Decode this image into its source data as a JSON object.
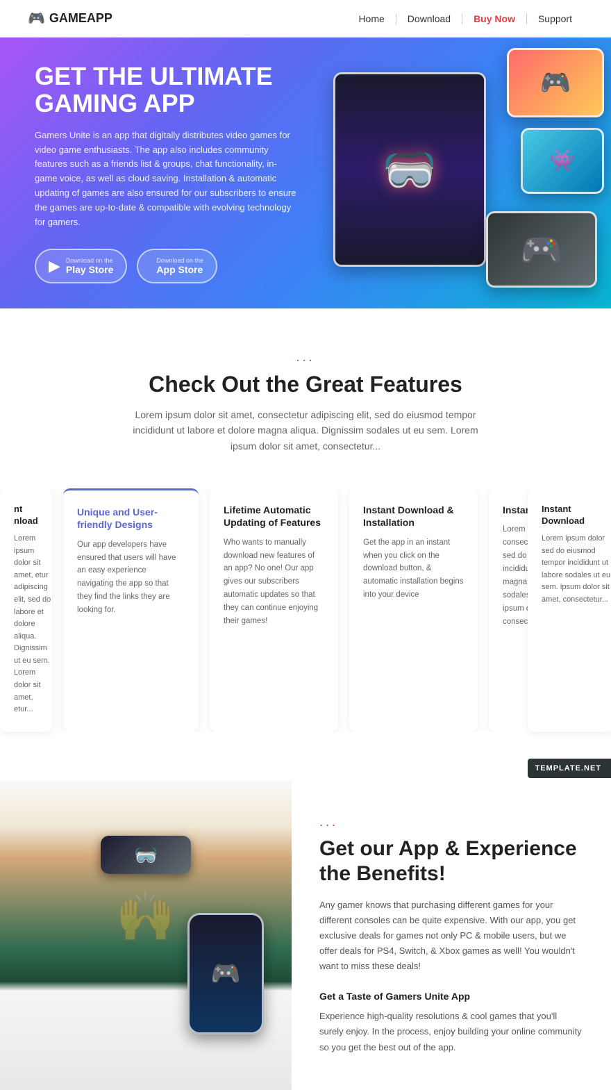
{
  "nav": {
    "logo_text": "GAMEAPP",
    "logo_icon": "🎮",
    "links": [
      {
        "label": "Home",
        "active": false
      },
      {
        "label": "Download",
        "active": false
      },
      {
        "label": "Buy Now",
        "active": true
      },
      {
        "label": "Support",
        "active": false
      }
    ]
  },
  "hero": {
    "title": "GET THE ULTIMATE GAMING APP",
    "description": "Gamers Unite is an app that digitally distributes video games for video game enthusiasts. The app also includes community features such as a friends list & groups, chat functionality, in-game voice, as well as cloud saving. Installation & automatic updating of games are also ensured for our subscribers to ensure the games are up-to-date & compatible with evolving technology for gamers.",
    "btn_playstore_small": "Download on the",
    "btn_playstore_big": "Play Store",
    "btn_appstore_small": "Download on the",
    "btn_appstore_big": "App Store"
  },
  "features": {
    "dots": "...",
    "title": "Check Out the Great Features",
    "subtitle": "Lorem ipsum dolor sit amet, consectetur adipiscing elit, sed do eiusmod tempor incididunt ut labore et dolore magna aliqua. Dignissim sodales ut eu sem. Lorem ipsum dolor sit amet, consectetur...",
    "cards": [
      {
        "id": "partial-left",
        "title": "nt nload",
        "body": "Lorem ipsum dolor sit amet, consectetur adipiscing elit, sed do eiusmod tempor incididunt ut labore et dolore magna aliqua. Dignissim sodales ut eu sem. Lorem dolor sit amet, etur..."
      },
      {
        "id": "unique",
        "title": "Unique and User-friendly Designs",
        "body": "Our app developers have ensured that users will have an easy experience navigating the app so that they find the links they are looking for.",
        "highlight": true
      },
      {
        "id": "lifetime",
        "title": "Lifetime Automatic Updating of Features",
        "body": "Who wants to manually download new features of an app? No one! Our app gives our subscribers automatic updates so that they can continue enjoying their games!"
      },
      {
        "id": "instant-download-install",
        "title": "Instant Download & Installation",
        "body": "Get the app in an instant when you click on the download button, & automatic installation begins into your device"
      },
      {
        "id": "instant-download",
        "title": "Instant Download",
        "body": "Lorem ipsum dolor sit amet, consectetur adipiscing elit, sed do eiusmod tempor incididunt ut labore et dolore magna aliqua. Dignissim sodales ut eu sem. Lorem ipsum dolor sit amet, consectetur..."
      },
      {
        "id": "partial-right",
        "title": "Instant Download",
        "body": "Lorem ipsum dolor sit amet, sed do eiusmod tempor incididunt ut labore sodales ut eu sem. ipsum dolor sit amet, consectetur..."
      }
    ]
  },
  "benefits": {
    "dots": "...",
    "title": "Get our App & Experience the Benefits!",
    "description": "Any gamer knows that purchasing different games for your different consoles can be quite expensive. With our app, you get exclusive deals for games not only PC & mobile users, but we offer deals for PS4, Switch, & Xbox games as well! You wouldn't want to miss these deals!",
    "subtitle2": "Get a Taste of Gamers Unite App",
    "description2": "Experience high-quality resolutions & cool games that you'll surely enjoy. In the process, enjoy building your online community so you get the best out of the app."
  },
  "template_badge": "TEMPLATE.NET"
}
